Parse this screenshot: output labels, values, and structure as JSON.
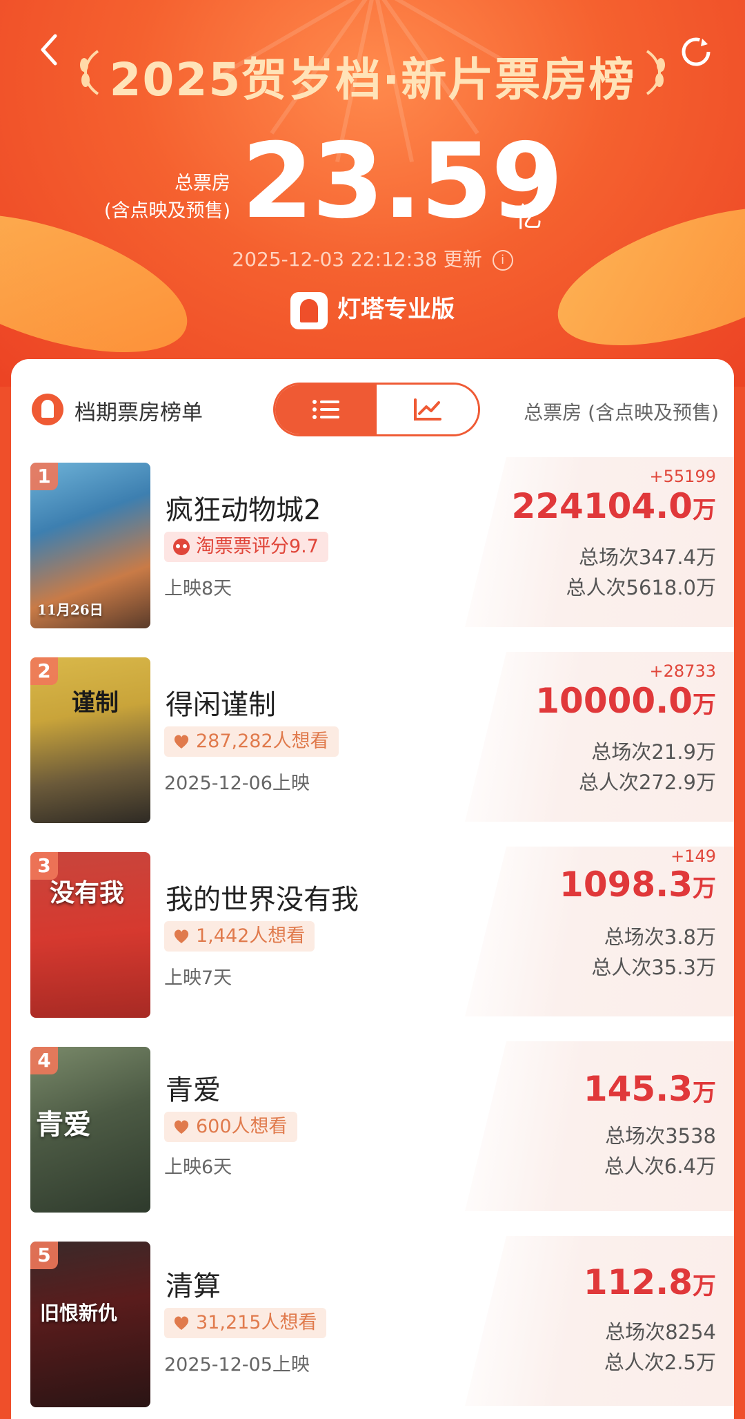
{
  "header": {
    "title": "2025贺岁档·新片票房榜",
    "total_label_line1": "总票房",
    "total_label_line2": "(含点映及预售)",
    "total_value": "23.59",
    "total_unit": "亿",
    "updated_time": "2025-12-03 22:12:38",
    "updated_suffix": "更新",
    "brand": "灯塔专业版"
  },
  "list_header": {
    "title": "档期票房榜单",
    "right_label": "总票房 (含点映及预售)"
  },
  "movies": [
    {
      "rank": "1",
      "title": "疯狂动物城2",
      "tag": "淘票票评分9.7",
      "tag_type": "rating",
      "release": "上映8天",
      "delta": "+55199",
      "box": "224104.0",
      "unit": "万",
      "shows": "总场次347.4万",
      "viewers": "总人次5618.0万"
    },
    {
      "rank": "2",
      "title": "得闲谨制",
      "tag": "287,282人想看",
      "tag_type": "want",
      "release": "2025-12-06上映",
      "delta": "+28733",
      "box": "10000.0",
      "unit": "万",
      "shows": "总场次21.9万",
      "viewers": "总人次272.9万"
    },
    {
      "rank": "3",
      "title": "我的世界没有我",
      "tag": "1,442人想看",
      "tag_type": "want",
      "release": "上映7天",
      "delta": "+149",
      "box": "1098.3",
      "unit": "万",
      "shows": "总场次3.8万",
      "viewers": "总人次35.3万"
    },
    {
      "rank": "4",
      "title": "青爱",
      "tag": "600人想看",
      "tag_type": "want",
      "release": "上映6天",
      "delta": "",
      "box": "145.3",
      "unit": "万",
      "shows": "总场次3538",
      "viewers": "总人次6.4万"
    },
    {
      "rank": "5",
      "title": "清算",
      "tag": "31,215人想看",
      "tag_type": "want",
      "release": "2025-12-05上映",
      "delta": "",
      "box": "112.8",
      "unit": "万",
      "shows": "总场次8254",
      "viewers": "总人次2.5万"
    }
  ],
  "posters": [
    {
      "text": "11月26日"
    },
    {
      "text": "谨制"
    },
    {
      "text": "没有我"
    },
    {
      "text": "青爱"
    },
    {
      "text": "旧恨新仇"
    }
  ],
  "colors": {
    "accent": "#ef5a34",
    "box_red": "#e0383a",
    "title_gold": "#ffe3b8"
  }
}
